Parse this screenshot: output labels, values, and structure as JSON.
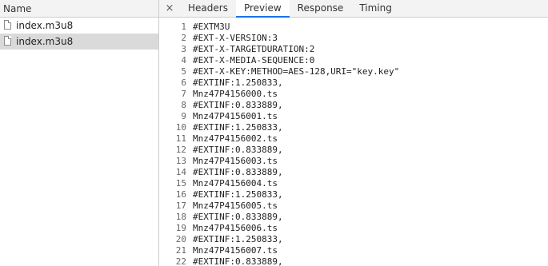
{
  "left": {
    "header": "Name",
    "requests": [
      {
        "name": "index.m3u8",
        "selected": false
      },
      {
        "name": "index.m3u8",
        "selected": true
      }
    ]
  },
  "tabs": {
    "close_glyph": "×",
    "items": [
      "Headers",
      "Preview",
      "Response",
      "Timing"
    ],
    "active": "Preview",
    "accent_color": "#1a73e8"
  },
  "code": {
    "lines": [
      {
        "n": "1",
        "t": "#EXTM3U"
      },
      {
        "n": "2",
        "t": "#EXT-X-VERSION:3"
      },
      {
        "n": "3",
        "t": "#EXT-X-TARGETDURATION:2"
      },
      {
        "n": "4",
        "t": "#EXT-X-MEDIA-SEQUENCE:0"
      },
      {
        "n": "5",
        "t": "#EXT-X-KEY:METHOD=AES-128,URI=\"key.key\""
      },
      {
        "n": "6",
        "t": "#EXTINF:1.250833,"
      },
      {
        "n": "7",
        "t": "Mnz47P4156000.ts"
      },
      {
        "n": "8",
        "t": "#EXTINF:0.833889,"
      },
      {
        "n": "9",
        "t": "Mnz47P4156001.ts"
      },
      {
        "n": "10",
        "t": "#EXTINF:1.250833,"
      },
      {
        "n": "11",
        "t": "Mnz47P4156002.ts"
      },
      {
        "n": "12",
        "t": "#EXTINF:0.833889,"
      },
      {
        "n": "13",
        "t": "Mnz47P4156003.ts"
      },
      {
        "n": "14",
        "t": "#EXTINF:0.833889,"
      },
      {
        "n": "15",
        "t": "Mnz47P4156004.ts"
      },
      {
        "n": "16",
        "t": "#EXTINF:1.250833,"
      },
      {
        "n": "17",
        "t": "Mnz47P4156005.ts"
      },
      {
        "n": "18",
        "t": "#EXTINF:0.833889,"
      },
      {
        "n": "19",
        "t": "Mnz47P4156006.ts"
      },
      {
        "n": "20",
        "t": "#EXTINF:1.250833,"
      },
      {
        "n": "21",
        "t": "Mnz47P4156007.ts"
      },
      {
        "n": "22",
        "t": "#EXTINF:0.833889,"
      }
    ]
  }
}
